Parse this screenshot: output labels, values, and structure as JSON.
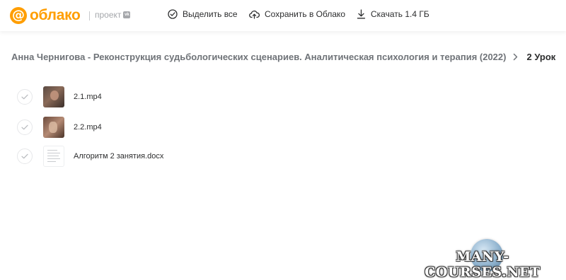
{
  "header": {
    "logo_text": "облако",
    "project_label": "проект",
    "vk_badge": "vk",
    "actions": {
      "select_all": "Выделить все",
      "save_to_cloud": "Сохранить в Облако",
      "download": "Скачать 1.4 ГБ"
    }
  },
  "breadcrumb": {
    "parent": "Анна Чернигова - Реконструкция судьбологических сценариев. Аналитическая психология и терапия (2022)",
    "current": "2 Урок"
  },
  "files": [
    {
      "name": "2.1.mp4",
      "type": "video"
    },
    {
      "name": "2.2.mp4",
      "type": "video"
    },
    {
      "name": "Алгоритм 2 занятия.docx",
      "type": "docx"
    }
  ],
  "watermark": {
    "text": "MANY-COURSES.NET"
  },
  "colors": {
    "brand": "#ff9e00",
    "text": "#2c2d2e",
    "muted": "#a5a7ab"
  }
}
